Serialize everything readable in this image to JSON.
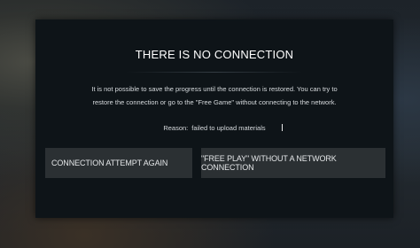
{
  "dialog": {
    "title": "THERE IS NO CONNECTION",
    "message_line1": "It is not possible to save the progress until the connection is restored. You can try to",
    "message_line2": "restore the connection or go to the \"Free Game\" without connecting to the network.",
    "reason_prefix": "Reason:",
    "reason_text": "failed to upload materials",
    "buttons": {
      "retry_label": "CONNECTION ATTEMPT AGAIN",
      "offline_label": "\"FREE PLAY\" WITHOUT A NETWORK CONNECTION"
    }
  },
  "colors": {
    "dialog_bg": "#0e1418",
    "button_bg": "#2b3033",
    "text": "#ffffff"
  }
}
